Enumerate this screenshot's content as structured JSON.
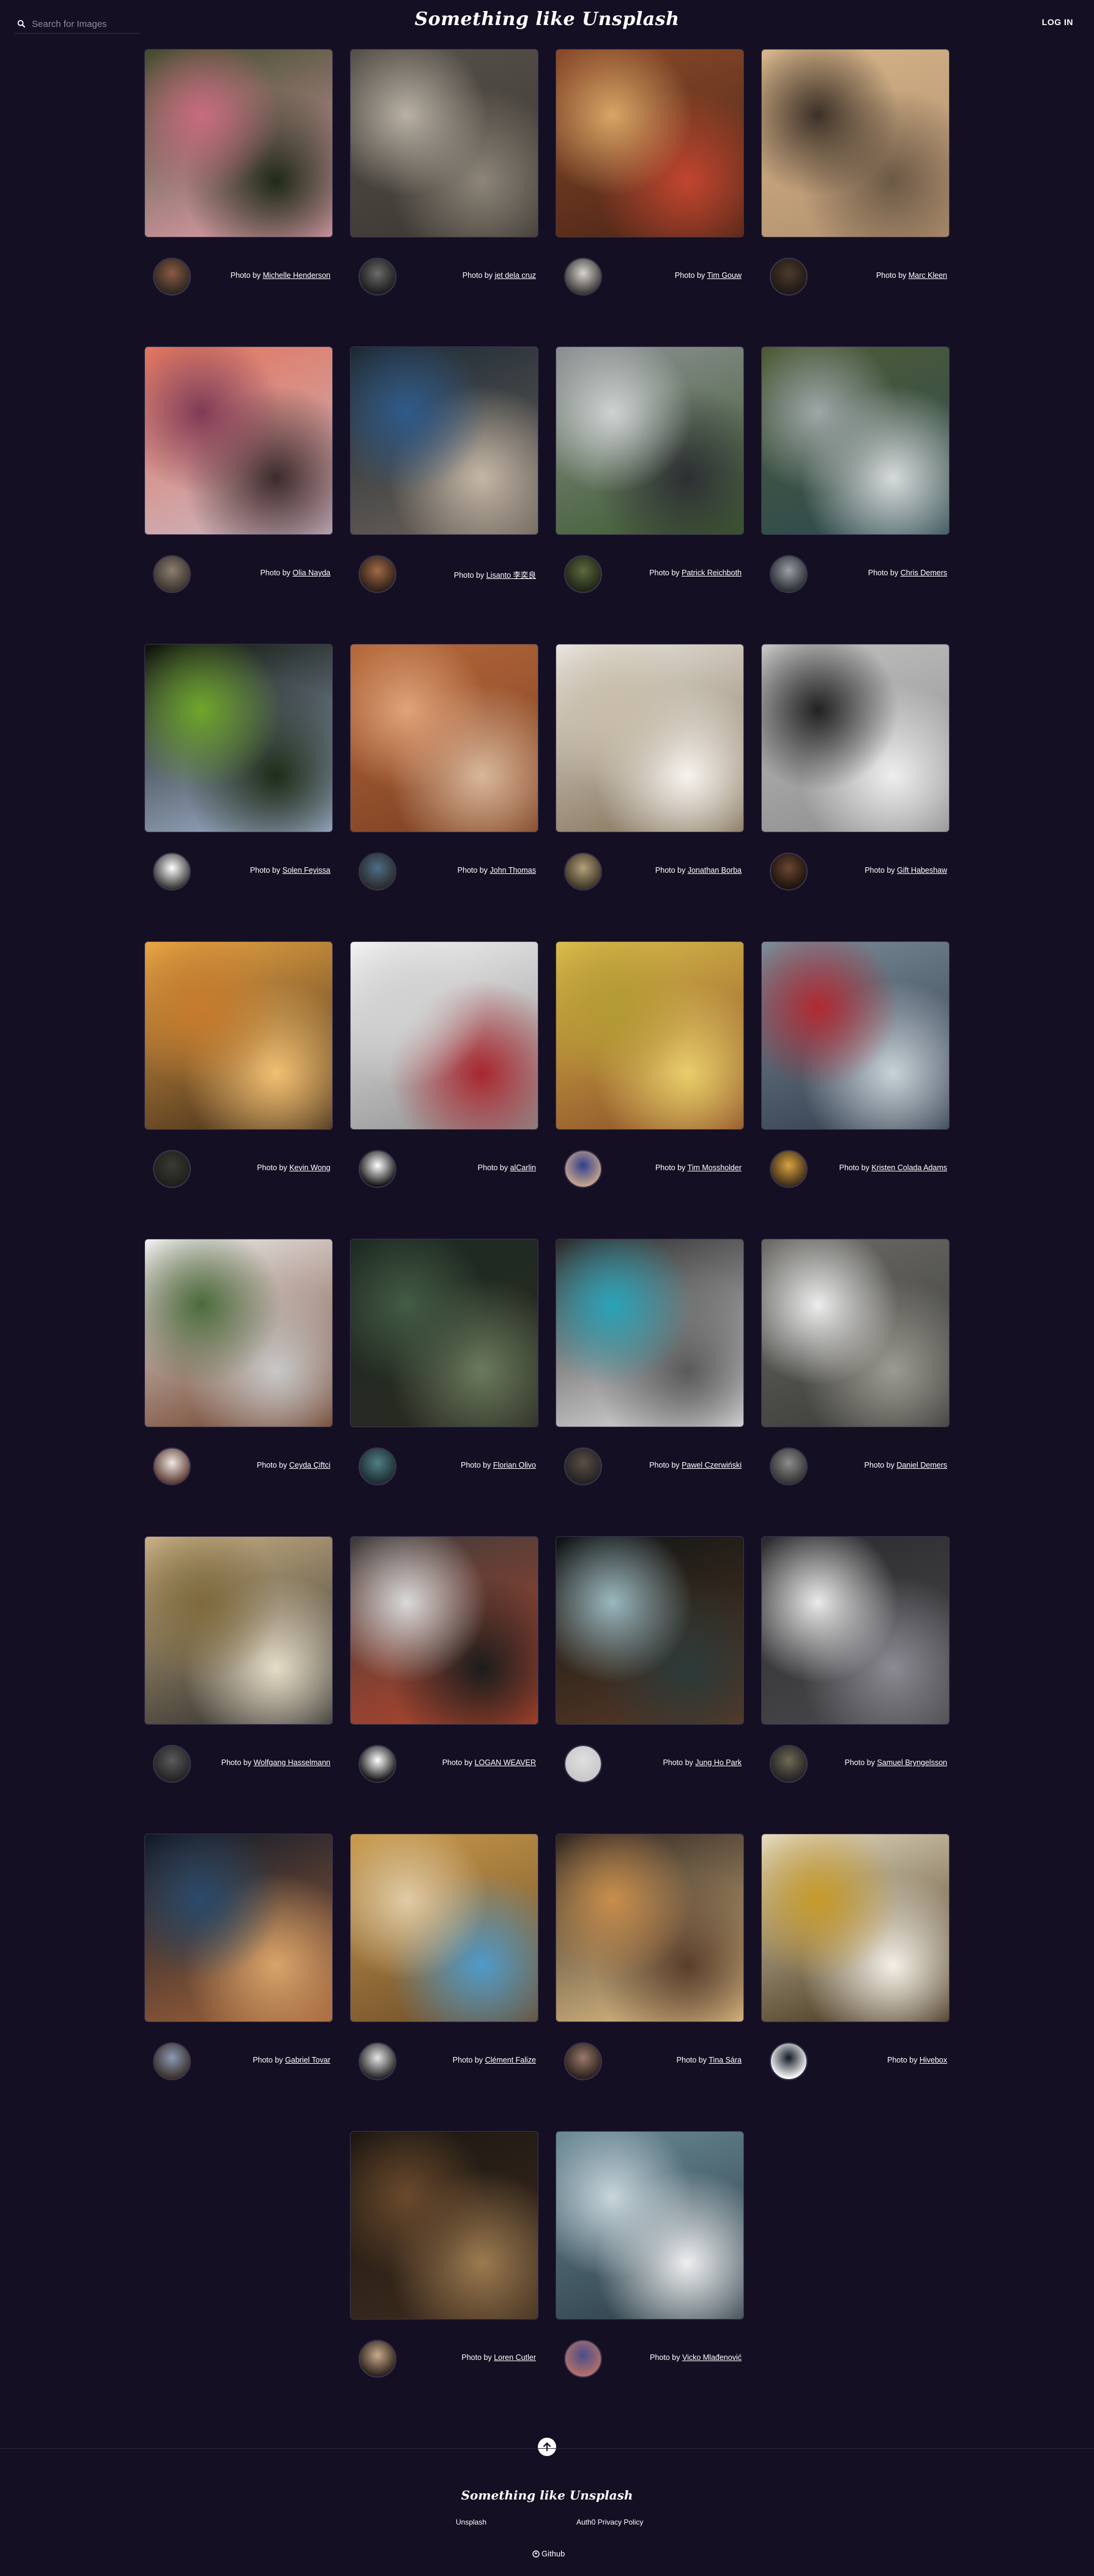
{
  "header": {
    "search_placeholder": "Search for Images",
    "title": "Something like Unsplash",
    "login_label": "LOG IN"
  },
  "credit_prefix": "Photo by ",
  "photos": [
    {
      "author": "Michelle Henderson",
      "colors": [
        "#3f4b2c",
        "#c86b7e",
        "#e7a3b3",
        "#1f2a17"
      ],
      "avatar_colors": [
        "#8a5a44",
        "#2d2620"
      ]
    },
    {
      "author": "jet dela cruz",
      "colors": [
        "#57524b",
        "#b9b1a4",
        "#3a3631",
        "#8d8578"
      ],
      "avatar_colors": [
        "#6b6b6b",
        "#1b1b1b"
      ]
    },
    {
      "author": "Tim Gouw",
      "colors": [
        "#8a4a2a",
        "#d9a566",
        "#4a2416",
        "#c2452f"
      ],
      "avatar_colors": [
        "#d8d4cf",
        "#3a3634"
      ]
    },
    {
      "author": "Marc Kleen",
      "colors": [
        "#d6b58a",
        "#3b3027",
        "#b08f6e",
        "#6b5846"
      ],
      "avatar_colors": [
        "#4d3a2c",
        "#1e1814"
      ]
    },
    {
      "author": "Olia Nayda",
      "colors": [
        "#e2745c",
        "#7f3b56",
        "#c9b8c4",
        "#3d2a2c"
      ],
      "avatar_colors": [
        "#8b7e6e",
        "#3a342d"
      ]
    },
    {
      "author": "Lisanto 李奕良",
      "colors": [
        "#1c2a36",
        "#2f5a8a",
        "#6e6358",
        "#c5b7a6"
      ],
      "avatar_colors": [
        "#a06a45",
        "#2d1f17"
      ]
    },
    {
      "author": "Patrick Reichboth",
      "colors": [
        "#8e9195",
        "#cfd2d3",
        "#3b5a2c",
        "#2d2f33"
      ],
      "avatar_colors": [
        "#5b6a3f",
        "#1f2315"
      ]
    },
    {
      "author": "Chris Demers",
      "colors": [
        "#4f5b36",
        "#9ea7a8",
        "#2a4a52",
        "#d7dadb"
      ],
      "avatar_colors": [
        "#9aa0a6",
        "#2b2e33"
      ]
    },
    {
      "author": "Solen Feyissa",
      "colors": [
        "#0d1207",
        "#6fa62a",
        "#a7b8d6",
        "#1e2c18"
      ],
      "avatar_colors": [
        "#ffffff",
        "#333333"
      ]
    },
    {
      "author": "John Thomas",
      "colors": [
        "#b6683a",
        "#e0a37a",
        "#7a3f22",
        "#d9b79a"
      ],
      "avatar_colors": [
        "#4c6e88",
        "#2a2a2a"
      ]
    },
    {
      "author": "Jonathan Borba",
      "colors": [
        "#e9e5de",
        "#c9bda9",
        "#7c6a50",
        "#f6f3ee"
      ],
      "avatar_colors": [
        "#b5a27c",
        "#3c3424"
      ]
    },
    {
      "author": "Gift Habeshaw",
      "colors": [
        "#c2c2c2",
        "#222222",
        "#8a8a8a",
        "#eeeeee"
      ],
      "avatar_colors": [
        "#6b4632",
        "#1a120d"
      ]
    },
    {
      "author": "Kevin Wong",
      "colors": [
        "#e9a544",
        "#c77b2d",
        "#3d2a1b",
        "#f2c072"
      ],
      "avatar_colors": [
        "#3b3b35",
        "#1e1e1a"
      ]
    },
    {
      "author": "alCarlin",
      "colors": [
        "#f2f2f2",
        "#d1d1d1",
        "#8c8c8c",
        "#a8262e"
      ],
      "avatar_colors": [
        "#ffffff",
        "#111111"
      ]
    },
    {
      "author": "Tim Mossholder",
      "colors": [
        "#d9bd4a",
        "#b39a33",
        "#8a4a28",
        "#e8cf6a"
      ],
      "avatar_colors": [
        "#2f3f8e",
        "#c9a58c"
      ]
    },
    {
      "author": "Kristen Colada Adams",
      "colors": [
        "#7b8c98",
        "#b02a33",
        "#2f3a4a",
        "#c8d2d8"
      ],
      "avatar_colors": [
        "#d9a441",
        "#3a2a18"
      ]
    },
    {
      "author": "Ceyda Çiftci",
      "colors": [
        "#eeeeee",
        "#4b6b3c",
        "#6a3b24",
        "#c8c8c8"
      ],
      "avatar_colors": [
        "#efe8e2",
        "#5a3a32"
      ]
    },
    {
      "author": "Florian Olivo",
      "colors": [
        "#1c2a22",
        "#445c45",
        "#2b2a22",
        "#6b7a5c"
      ],
      "avatar_colors": [
        "#4f7f86",
        "#1c2b2e"
      ]
    },
    {
      "author": "Pawel Czerwiński",
      "colors": [
        "#2a2a2a",
        "#2aa3b8",
        "#e6e6e6",
        "#5a5a5a"
      ],
      "avatar_colors": [
        "#5a4e46",
        "#222222"
      ]
    },
    {
      "author": "Daniel Demers",
      "colors": [
        "#6c6b66",
        "#ededed",
        "#3a3a36",
        "#9c9a92"
      ],
      "avatar_colors": [
        "#8c8c8c",
        "#333333"
      ]
    },
    {
      "author": "Wolfgang Hasselmann",
      "colors": [
        "#c9b083",
        "#7e6a3c",
        "#2b2b2b",
        "#e6dcc7"
      ],
      "avatar_colors": [
        "#5b5b5b",
        "#222222"
      ]
    },
    {
      "author": "LOGAN WEAVER",
      "colors": [
        "#3d3b3b",
        "#d9d9d9",
        "#b7452b",
        "#1c1c1c"
      ],
      "avatar_colors": [
        "#ffffff",
        "#111111"
      ]
    },
    {
      "author": "Jung Ho Park",
      "colors": [
        "#0e1414",
        "#9ab8bf",
        "#5a3a26",
        "#2c3a3a"
      ],
      "avatar_colors": [
        "#e0e0e0",
        "#c7c7c7"
      ]
    },
    {
      "author": "Samuel Bryngelsson",
      "colors": [
        "#2b2b2d",
        "#ebeaea",
        "#4a4a4d",
        "#8c8a92"
      ],
      "avatar_colors": [
        "#6e6a56",
        "#222222"
      ]
    },
    {
      "author": "Gabriel Tovar",
      "colors": [
        "#0f1a2a",
        "#2a4a6a",
        "#a5643a",
        "#d9a46a"
      ],
      "avatar_colors": [
        "#8c9ab6",
        "#3a2f2a"
      ]
    },
    {
      "author": "Clément Falize",
      "colors": [
        "#c99a4a",
        "#e0cba6",
        "#6a4a2a",
        "#4f9ac9"
      ],
      "avatar_colors": [
        "#e6e6e6",
        "#222222"
      ]
    },
    {
      "author": "Tina Sára",
      "colors": [
        "#2e2420",
        "#c88e4c",
        "#e8c78c",
        "#5a3e2c"
      ],
      "avatar_colors": [
        "#9a7a6a",
        "#2a201c"
      ]
    },
    {
      "author": "Hivebox",
      "colors": [
        "#e6dcc0",
        "#c79a2a",
        "#3a2a12",
        "#f4efe6"
      ],
      "avatar_colors": [
        "#0f1a24",
        "#ffffff"
      ]
    },
    {
      "author": "Loren Cutler",
      "colors": [
        "#1c1712",
        "#6a4a2c",
        "#3e2c1e",
        "#9c7a50"
      ],
      "avatar_colors": [
        "#c9aa8a",
        "#2a211a"
      ]
    },
    {
      "author": "Vicko Mlađenović",
      "colors": [
        "#6a8a96",
        "#c9d6dc",
        "#2a3a44",
        "#eeeeee"
      ],
      "avatar_colors": [
        "#4a4e8a",
        "#b4706a"
      ]
    }
  ],
  "footer": {
    "title": "Something like Unsplash",
    "links": [
      "Unsplash",
      "Auth0 Privacy Policy"
    ],
    "github_label": "Github"
  }
}
